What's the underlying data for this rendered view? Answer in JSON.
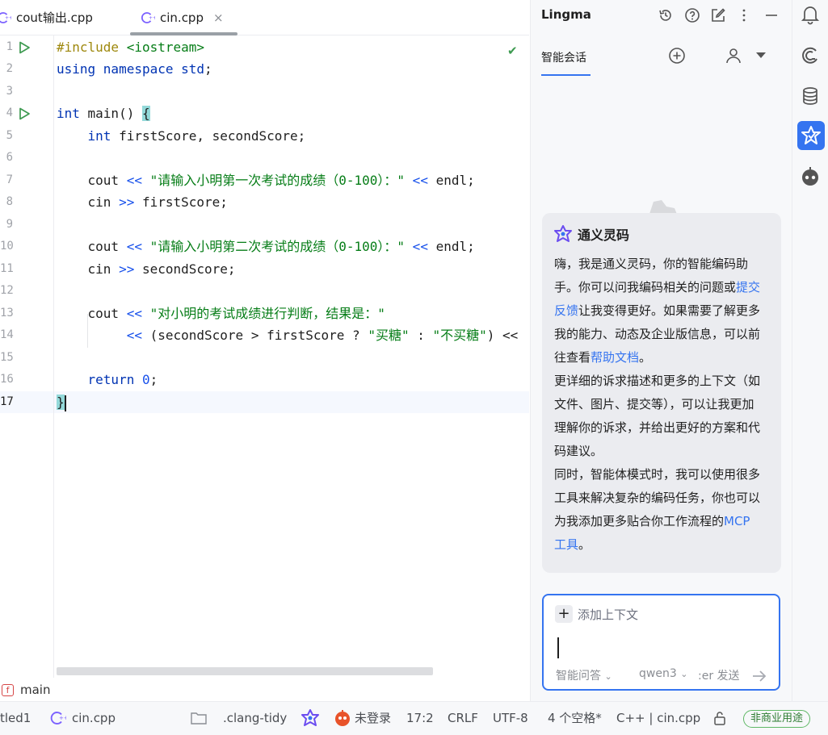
{
  "tabs": [
    {
      "label": "cout输出.cpp"
    },
    {
      "label": "cin.cpp",
      "close": "×"
    }
  ],
  "editor": {
    "line_numbers": [
      "1",
      "2",
      "3",
      "4",
      "5",
      "6",
      "7",
      "8",
      "9",
      "10",
      "11",
      "12",
      "13",
      "14",
      "15",
      "16",
      "17"
    ],
    "lines": {
      "l1_a": "#include ",
      "l1_b": "<iostream>",
      "l2_a": "using namespace ",
      "l2_b": "std",
      "l2_c": ";",
      "l4_a": "int ",
      "l4_b": "main() ",
      "l4_c": "{",
      "l5_a": "    int ",
      "l5_b": "firstScore, secondScore;",
      "l7_a": "    cout ",
      "l7_b": "<< ",
      "l7_c": "\"请输入小明第一次考试的成绩（0-100）：\"",
      "l7_d": " << ",
      "l7_e": "endl;",
      "l8_a": "    cin ",
      "l8_b": ">> ",
      "l8_c": "firstScore;",
      "l10_a": "    cout ",
      "l10_b": "<< ",
      "l10_c": "\"请输入小明第二次考试的成绩（0-100）：\"",
      "l10_d": " << ",
      "l10_e": "endl;",
      "l11_a": "    cin ",
      "l11_b": ">> ",
      "l11_c": "secondScore;",
      "l13_a": "    cout ",
      "l13_b": "<< ",
      "l13_c": "\"对小明的考试成绩进行判断，结果是：\"",
      "l14_a": "         << ",
      "l14_b": "(secondScore > firstScore ? ",
      "l14_c": "\"买糖\"",
      "l14_d": " : ",
      "l14_e": "\"不买糖\"",
      "l14_f": ") <<",
      "l16_a": "    return ",
      "l16_b": "0",
      "l16_c": ";",
      "l17_a": "}"
    }
  },
  "breadcrumb": {
    "badge": "f",
    "label": "main"
  },
  "statusbar": {
    "project": "tled1",
    "file": "cin.cpp",
    "clang_tidy": ".clang-tidy",
    "login": "未登录",
    "position": "17:2",
    "line_ending": "CRLF",
    "encoding": "UTF-8",
    "indent": "4 个空格*",
    "context": "C++ | cin.cpp",
    "license": "非商业用途"
  },
  "lingma": {
    "title": "Lingma",
    "tab_chat": "智能会话",
    "bubble_title": "通义灵码",
    "p1_a": "嗨，我是通义灵码，你的智能编码助手。你可以问我编码相关的问题或",
    "p1_link": "提交反馈",
    "p1_b": "让我变得更好。如果需要了解更多我的能力、动态及企业版信息，可以前往查看",
    "p1_link2": "帮助文档",
    "p1_c": "。",
    "p2": "更详细的诉求描述和更多的上下文（如文件、图片、提交等），可以让我更加理解你的诉求，并给出更好的方案和代码建议。",
    "p3_a": "同时，智能体模式时，我可以使用很多工具来解决复杂的编码任务，你也可以为我添加更多贴合你工作流程的",
    "p3_link": "MCP 工具",
    "p3_b": "。",
    "add_context": "添加上下文",
    "mode": "智能问答",
    "model": "qwen3",
    "send_hint": ":er 发送"
  },
  "colors": {
    "accent": "#3574f0",
    "keyword": "#0033b3",
    "string": "#067d17",
    "number": "#1750eb"
  }
}
